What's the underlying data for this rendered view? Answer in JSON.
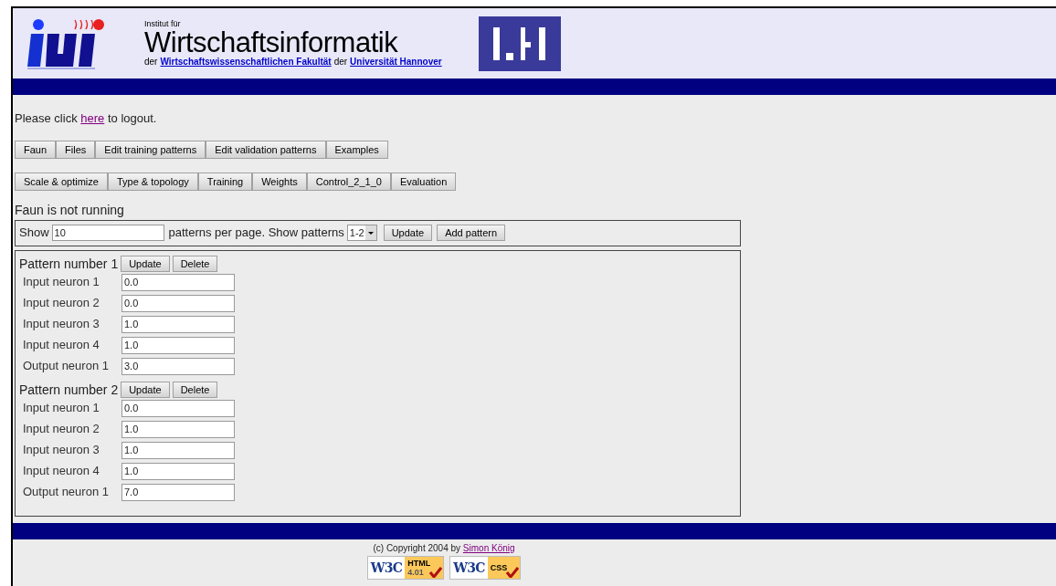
{
  "header": {
    "overline": "Institut für",
    "title": "Wirtschaftsinformatik",
    "subline": [
      {
        "kind": "text",
        "text": "der"
      },
      {
        "kind": "link",
        "text": "Wirtschaftswissenschaftlichen Fakultät"
      },
      {
        "kind": "text",
        "text": "der"
      },
      {
        "kind": "link",
        "text": "Universität Hannover"
      }
    ]
  },
  "logout": {
    "before": "Please click",
    "link": "here",
    "after": "to logout."
  },
  "nav_primary": [
    "Faun",
    "Files",
    "Edit training patterns",
    "Edit validation patterns",
    "Examples"
  ],
  "nav_secondary": [
    "Scale & optimize",
    "Type & topology",
    "Training",
    "Weights",
    "Control_2_1_0",
    "Evaluation"
  ],
  "status": "Faun is not running",
  "toolbar": {
    "show_label": "Show",
    "per_page": "10",
    "middle_label": "patterns per page. Show patterns",
    "range": "1-2",
    "update_button": "Update",
    "add_button": "Add pattern"
  },
  "patterns": [
    {
      "title": "Pattern number 1",
      "update_button": "Update",
      "delete_button": "Delete",
      "fields": [
        {
          "label": "Input neuron 1",
          "value": "0.0"
        },
        {
          "label": "Input neuron 2",
          "value": "0.0"
        },
        {
          "label": "Input neuron 3",
          "value": "1.0"
        },
        {
          "label": "Input neuron 4",
          "value": "1.0"
        },
        {
          "label": "Output neuron 1",
          "value": "3.0"
        }
      ]
    },
    {
      "title": "Pattern number 2",
      "update_button": "Update",
      "delete_button": "Delete",
      "fields": [
        {
          "label": "Input neuron 1",
          "value": "0.0"
        },
        {
          "label": "Input neuron 2",
          "value": "1.0"
        },
        {
          "label": "Input neuron 3",
          "value": "1.0"
        },
        {
          "label": "Input neuron 4",
          "value": "1.0"
        },
        {
          "label": "Output neuron 1",
          "value": "7.0"
        }
      ]
    }
  ],
  "footer": {
    "copyright": "(c) Copyright 2004 by",
    "author": "Simon König",
    "badges": [
      {
        "mark": "W3C",
        "label": "HTML",
        "version": "4.01"
      },
      {
        "mark": "W3C",
        "label": "CSS"
      }
    ]
  }
}
